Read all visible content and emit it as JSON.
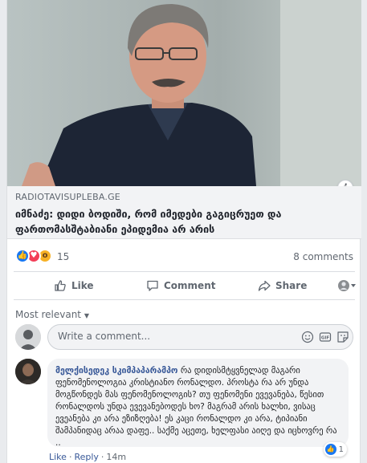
{
  "post": {
    "link": {
      "domain": "RADIOTAVISUPLEBA.GE",
      "headline": "იმნაძე: დიდი ბოდიში, რომ იმედები გაგიცრუეთ და ფართომასშტაბიანი ეპიდემია არ არის"
    },
    "reactions": {
      "count": "15",
      "types": [
        "like-icon",
        "love-icon",
        "wow-icon"
      ]
    },
    "comments_count": "8 comments",
    "actions": {
      "like": "Like",
      "comment": "Comment",
      "share": "Share"
    },
    "colors": {
      "accent": "#1877f2",
      "link": "#385898",
      "love": "#f33e58",
      "wow": "#f7b125"
    }
  },
  "comments_section": {
    "sort_label": "Most relevant",
    "write_placeholder": "Write a comment...",
    "items": [
      {
        "author": "მელქისედეკ სკიმპაპარამპო",
        "text": "რა დიდისმტყვნელად მაგარი ფენომენოლოგია კრისტიანო რონალდო. პროსტა რა არ უნდა მოგწონდეს მას ფენომენოლოგის? თუ ფენომენი ევევანება, წესით რონალდოს უნდა ევევანებოდეს ხო? მაგრამ არის ხალხი, ვისაც ევეანება კი არა ეზიზღება! ეს კაცი რონალდო კი არა, ტიპიანი შამპანიდაც არაა დაფე.. საქმე აცეთე, ხელფასი აიღე და იცხოვრე რა ..",
        "reaction_count": "1",
        "like_label": "Like",
        "reply_label": "Reply",
        "time": "14m"
      }
    ]
  }
}
